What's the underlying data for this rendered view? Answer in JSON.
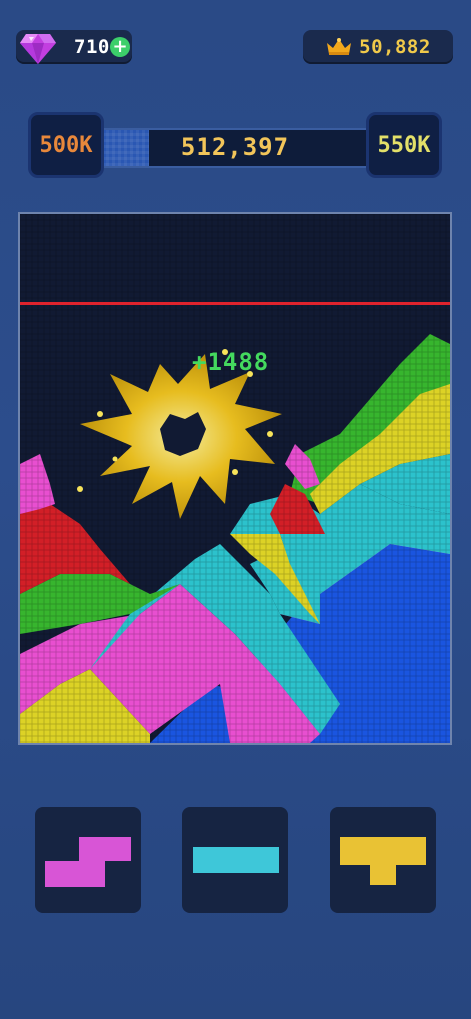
{
  "currency": {
    "gems": "710",
    "add_symbol": "+",
    "icon": "gem-icon"
  },
  "best_score": {
    "value": "50,882",
    "icon": "crown-icon"
  },
  "progress": {
    "left_milestone": "500K",
    "right_milestone": "550K",
    "score": "512,397",
    "fill_fraction": 0.18
  },
  "board": {
    "score_popup": "+1488"
  },
  "colors": {
    "magenta": "#e84fd0",
    "red": "#d21f27",
    "green": "#37b52e",
    "yellow": "#dcd226",
    "cyan": "#2cc2cc",
    "blue": "#1a55e0",
    "danger_line": "#e0232d"
  },
  "pieces": [
    {
      "name": "magenta-s-piece",
      "color": "#d855d6"
    },
    {
      "name": "cyan-bar-piece",
      "color": "#3ec7d9"
    },
    {
      "name": "yellow-t-piece",
      "color": "#e9c234"
    }
  ]
}
